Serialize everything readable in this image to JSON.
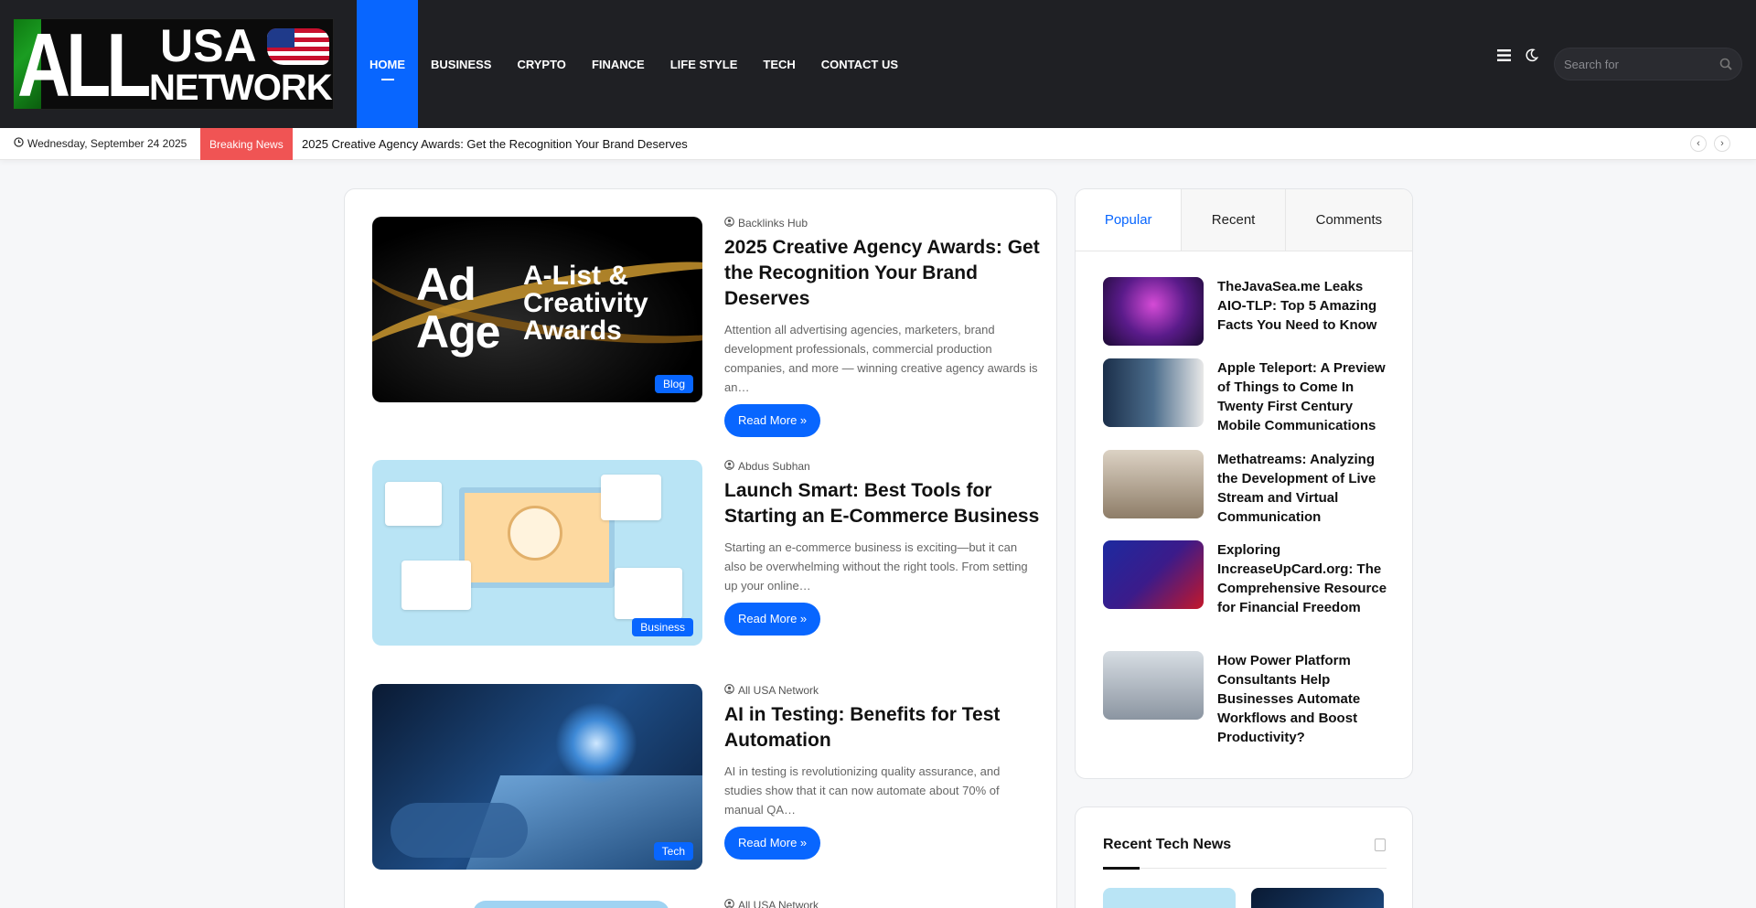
{
  "header": {
    "logo_all": "ALL",
    "logo_usa": "USA",
    "logo_network": "NETWORK",
    "nav": [
      "HOME",
      "BUSINESS",
      "CRYPTO",
      "FINANCE",
      "LIFE STYLE",
      "TECH",
      "CONTACT US"
    ],
    "search_placeholder": "Search for"
  },
  "topbar": {
    "date": "Wednesday, September 24 2025",
    "breaking_label": "Breaking News",
    "breaking_text": "2025 Creative Agency Awards: Get the Recognition Your Brand Deserves"
  },
  "posts": [
    {
      "author": "Backlinks Hub",
      "title": "2025 Creative Agency Awards: Get the Recognition Your Brand Deserves",
      "excerpt": "Attention all advertising agencies, marketers, brand development professionals, commercial production companies, and more — winning creative agency awards is an…",
      "category": "Blog",
      "read_more": "Read More »",
      "thumb_text_1": "Ad Age",
      "thumb_text_2": "A-List & Creativity Awards"
    },
    {
      "author": "Abdus Subhan",
      "title": "Launch Smart: Best Tools for Starting an E-Commerce Business",
      "excerpt": "Starting an e-commerce business is exciting—but it can also be overwhelming without the right tools. From setting up your online…",
      "category": "Business",
      "read_more": "Read More »"
    },
    {
      "author": "All USA Network",
      "title": "AI in Testing: Benefits for Test Automation",
      "excerpt": "AI in testing is revolutionizing quality assurance, and studies show that it can now automate about 70% of manual QA…",
      "category": "Tech",
      "read_more": "Read More »"
    },
    {
      "author": "All USA Network"
    }
  ],
  "sidebar": {
    "tabs": [
      "Popular",
      "Recent",
      "Comments"
    ],
    "popular": [
      "TheJavaSea.me Leaks AIO-TLP: Top 5 Amazing Facts You Need to Know",
      "Apple Teleport: A Preview of Things to Come In Twenty First Century Mobile Communications",
      "Methatreams: Analyzing the Development of Live Stream and Virtual Communication",
      "Exploring IncreaseUpCard.org: The Comprehensive Resource for Financial Freedom",
      "How Power Platform Consultants Help Businesses Automate Workflows and Boost Productivity?"
    ],
    "recent_tech_title": "Recent Tech News"
  }
}
